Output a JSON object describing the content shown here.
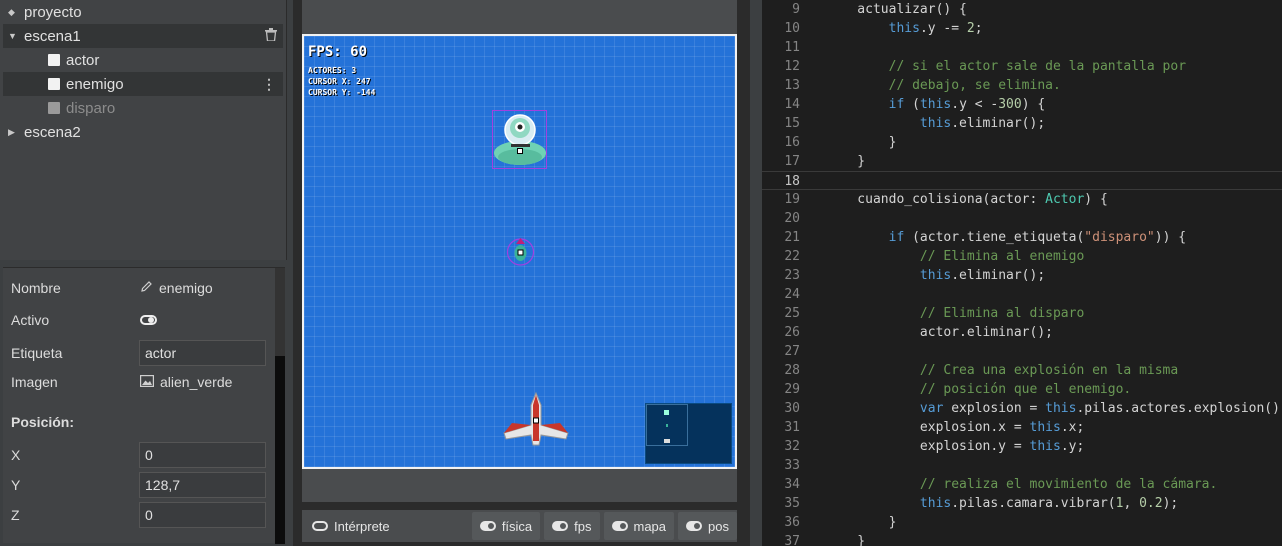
{
  "tree": {
    "project": "proyecto",
    "items": [
      {
        "label": "escena1"
      },
      {
        "label": "actor"
      },
      {
        "label": "enemigo"
      },
      {
        "label": "disparo"
      },
      {
        "label": "escena2"
      }
    ]
  },
  "inspector": {
    "nombre_label": "Nombre",
    "nombre_value": "enemigo",
    "activo_label": "Activo",
    "etiqueta_label": "Etiqueta",
    "etiqueta_value": "actor",
    "imagen_label": "Imagen",
    "imagen_value": "alien_verde",
    "posicion_title": "Posición:",
    "x_label": "X",
    "x_value": "0",
    "y_label": "Y",
    "y_value": "128,7",
    "z_label": "Z",
    "z_value": "0"
  },
  "canvas": {
    "fps": "FPS: 60",
    "actores": "ACTORES: 3",
    "cursor_x": "CURSOR X: 247",
    "cursor_y": "CURSOR Y: -144"
  },
  "toolbar": {
    "interprete": "Intérprete",
    "fisica": "física",
    "fps": "fps",
    "mapa": "mapa",
    "pos": "pos"
  },
  "code": {
    "lines": [
      {
        "n": "9",
        "t": "    actualizar() {"
      },
      {
        "n": "10",
        "t": "        this.y -= 2;"
      },
      {
        "n": "11",
        "t": ""
      },
      {
        "n": "12",
        "t": "        // si el actor sale de la pantalla por"
      },
      {
        "n": "13",
        "t": "        // debajo, se elimina."
      },
      {
        "n": "14",
        "t": "        if (this.y < -300) {"
      },
      {
        "n": "15",
        "t": "            this.eliminar();"
      },
      {
        "n": "16",
        "t": "        }"
      },
      {
        "n": "17",
        "t": "    }"
      },
      {
        "n": "18",
        "t": ""
      },
      {
        "n": "19",
        "t": "    cuando_colisiona(actor: Actor) {"
      },
      {
        "n": "20",
        "t": ""
      },
      {
        "n": "21",
        "t": "        if (actor.tiene_etiqueta(\"disparo\")) {"
      },
      {
        "n": "22",
        "t": "            // Elimina al enemigo"
      },
      {
        "n": "23",
        "t": "            this.eliminar();"
      },
      {
        "n": "24",
        "t": ""
      },
      {
        "n": "25",
        "t": "            // Elimina al disparo"
      },
      {
        "n": "26",
        "t": "            actor.eliminar();"
      },
      {
        "n": "27",
        "t": ""
      },
      {
        "n": "28",
        "t": "            // Crea una explosión en la misma"
      },
      {
        "n": "29",
        "t": "            // posición que el enemigo."
      },
      {
        "n": "30",
        "t": "            var explosion = this.pilas.actores.explosion();"
      },
      {
        "n": "31",
        "t": "            explosion.x = this.x;"
      },
      {
        "n": "32",
        "t": "            explosion.y = this.y;"
      },
      {
        "n": "33",
        "t": ""
      },
      {
        "n": "34",
        "t": "            // realiza el movimiento de la cámara."
      },
      {
        "n": "35",
        "t": "            this.pilas.camara.vibrar(1, 0.2);"
      },
      {
        "n": "36",
        "t": "        }"
      },
      {
        "n": "37",
        "t": "    }"
      }
    ]
  }
}
